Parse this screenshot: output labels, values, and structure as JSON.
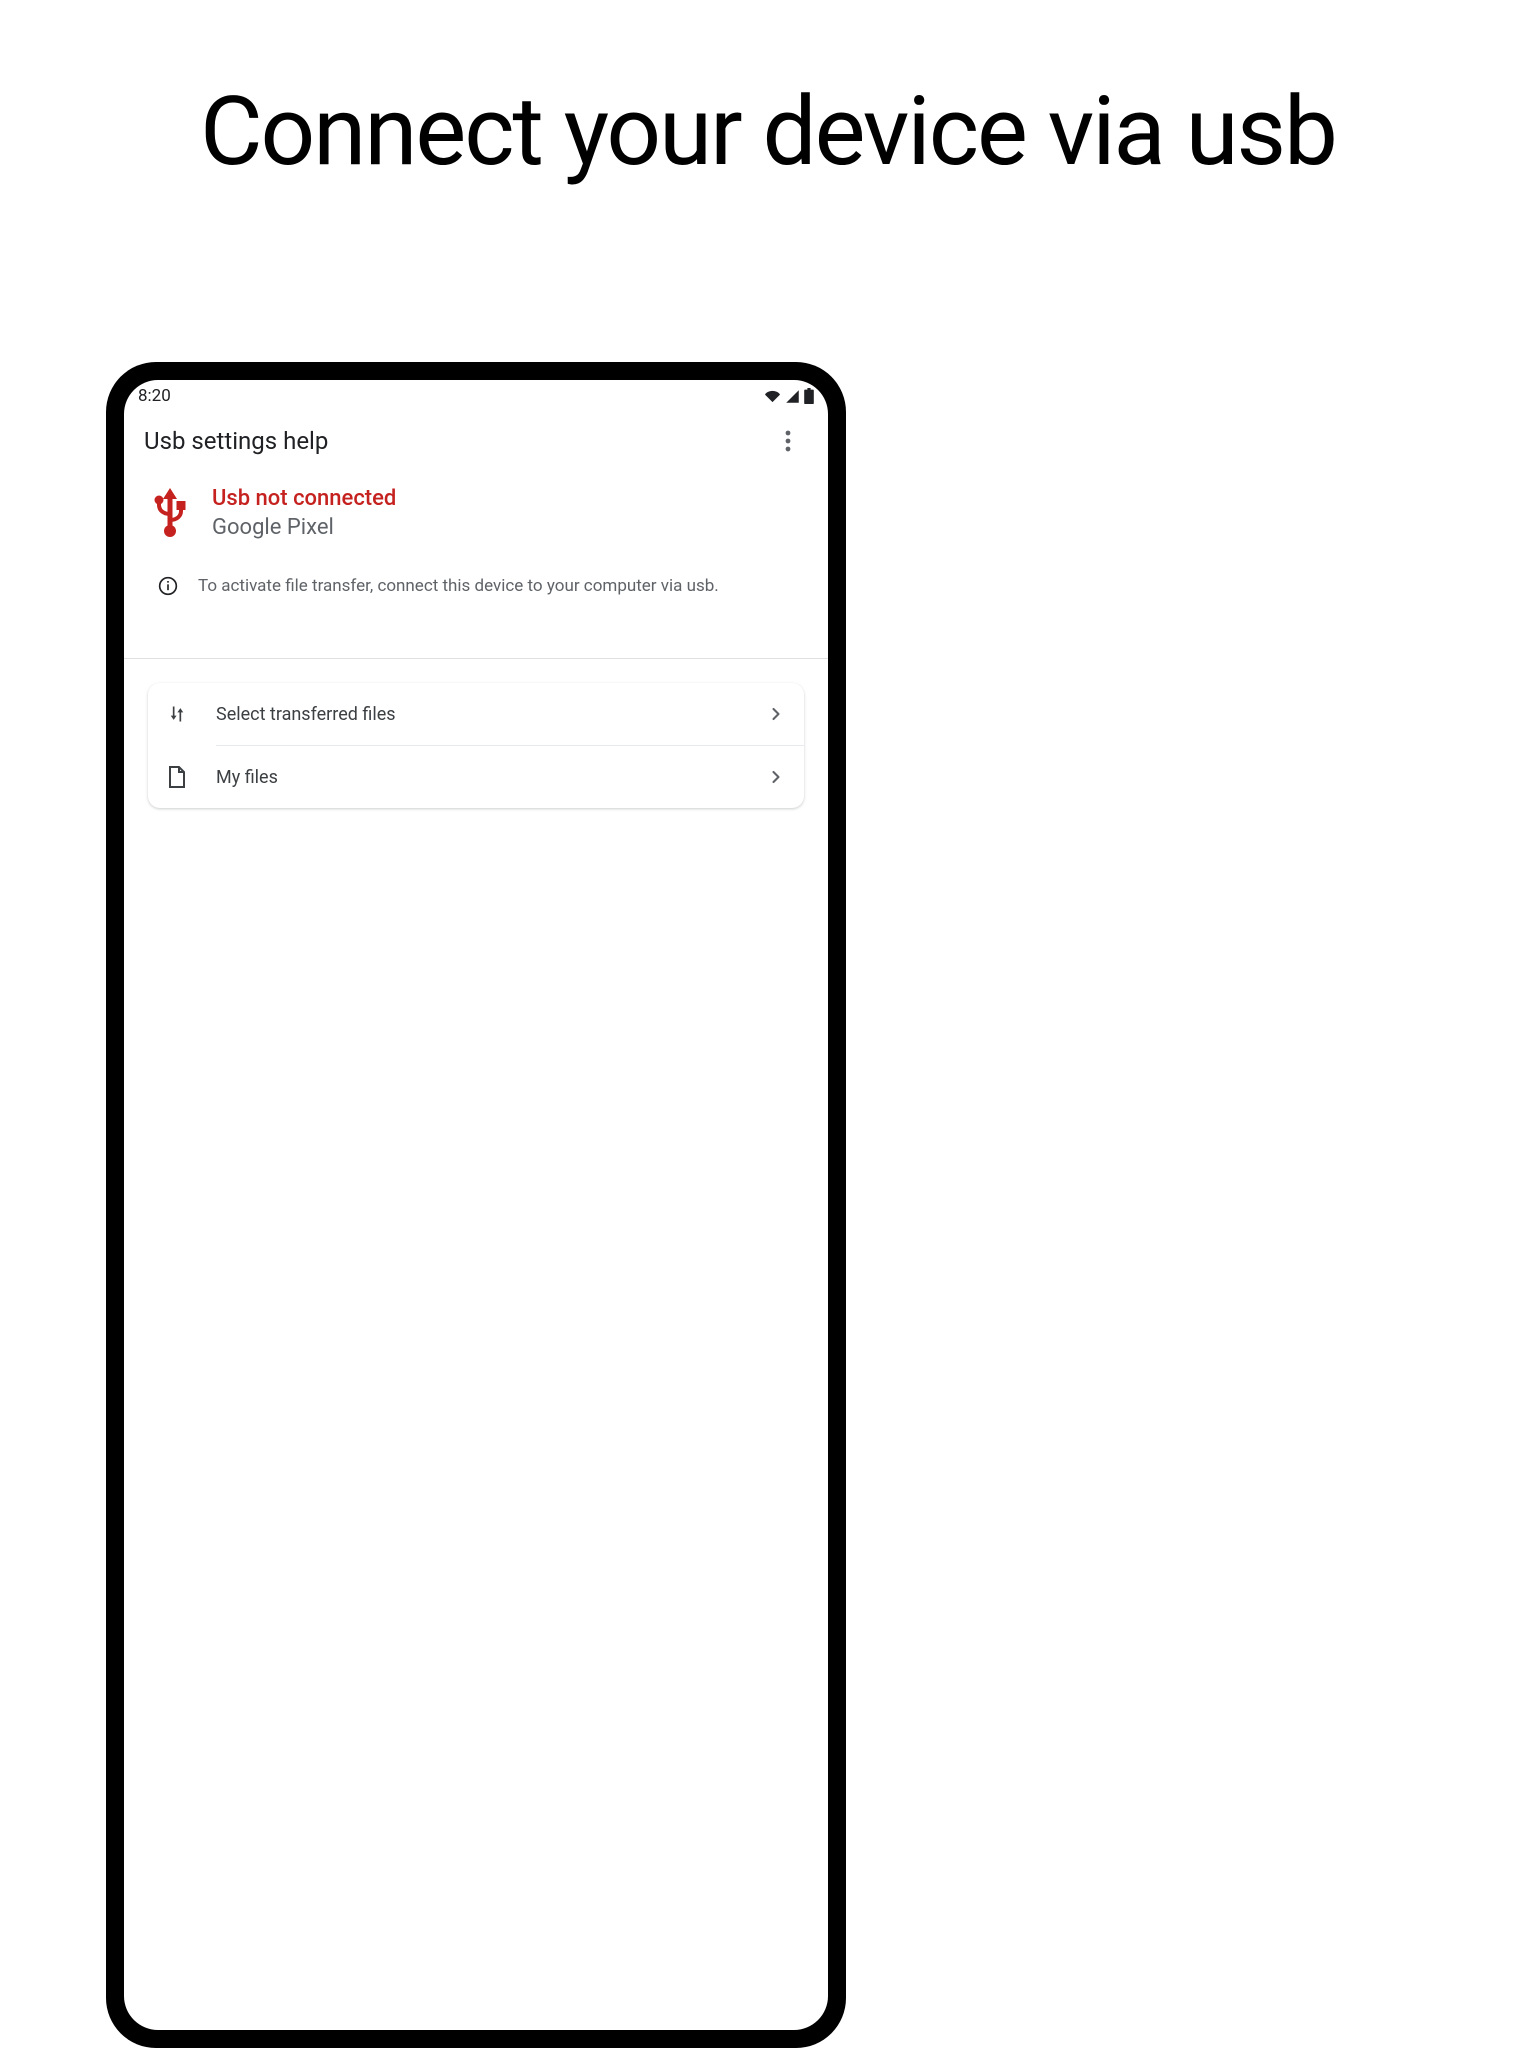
{
  "page_title": "Connect your device via usb",
  "status_bar": {
    "time": "8:20"
  },
  "header": {
    "title": "Usb settings help"
  },
  "status": {
    "title": "Usb not connected",
    "subtitle": "Google Pixel",
    "accent_color": "#c5221f"
  },
  "info": {
    "text": "To activate file transfer, connect this device to your computer via usb."
  },
  "menu": {
    "items": [
      {
        "label": "Select transferred files",
        "icon": "transfer-icon"
      },
      {
        "label": "My files",
        "icon": "file-icon"
      }
    ]
  }
}
